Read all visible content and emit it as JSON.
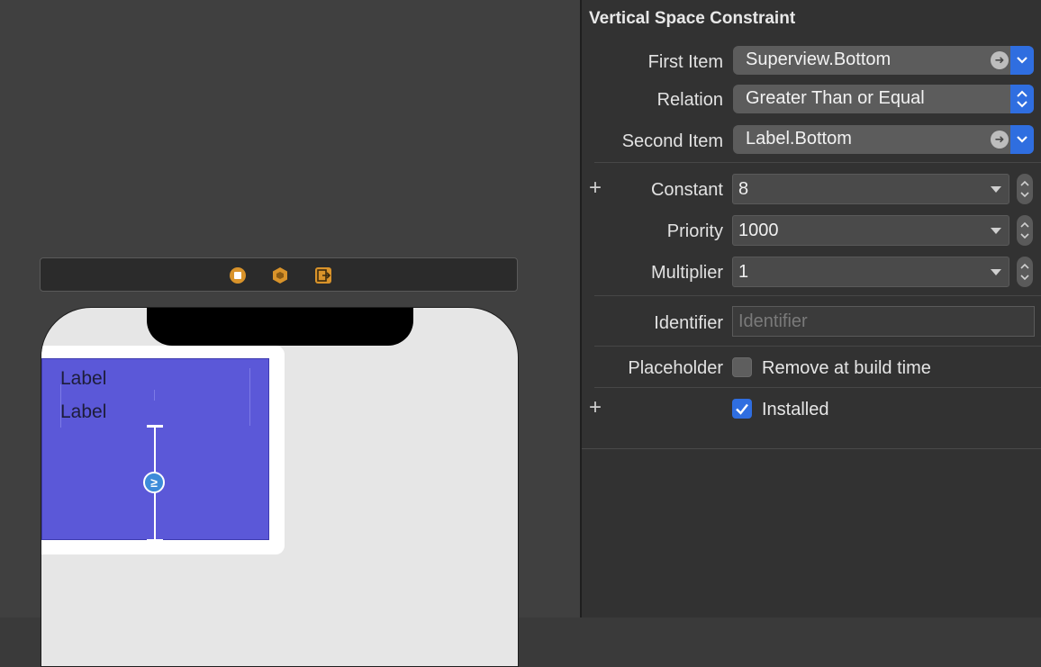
{
  "canvas": {
    "label_top": "Label",
    "label_bottom": "Label",
    "constraint_symbol": "≥"
  },
  "inspector": {
    "title": "Vertical Space Constraint",
    "first_item": {
      "label": "First Item",
      "value": "Superview.Bottom"
    },
    "relation": {
      "label": "Relation",
      "value": "Greater Than or Equal"
    },
    "second_item": {
      "label": "Second Item",
      "value": "Label.Bottom"
    },
    "constant": {
      "label": "Constant",
      "value": "8"
    },
    "priority": {
      "label": "Priority",
      "value": "1000"
    },
    "multiplier": {
      "label": "Multiplier",
      "value": "1"
    },
    "identifier": {
      "label": "Identifier",
      "placeholder": "Identifier",
      "value": ""
    },
    "placeholder": {
      "label": "Placeholder",
      "checkbox_label": "Remove at build time",
      "checked": false
    },
    "installed": {
      "checkbox_label": "Installed",
      "checked": true
    },
    "plus_symbol": "+"
  },
  "colors": {
    "view_blue": "#5b58d8",
    "accent_blue": "#2f6ee0",
    "badge_blue": "#3d8bd9",
    "scene_icon_orange": "#d9932a"
  }
}
